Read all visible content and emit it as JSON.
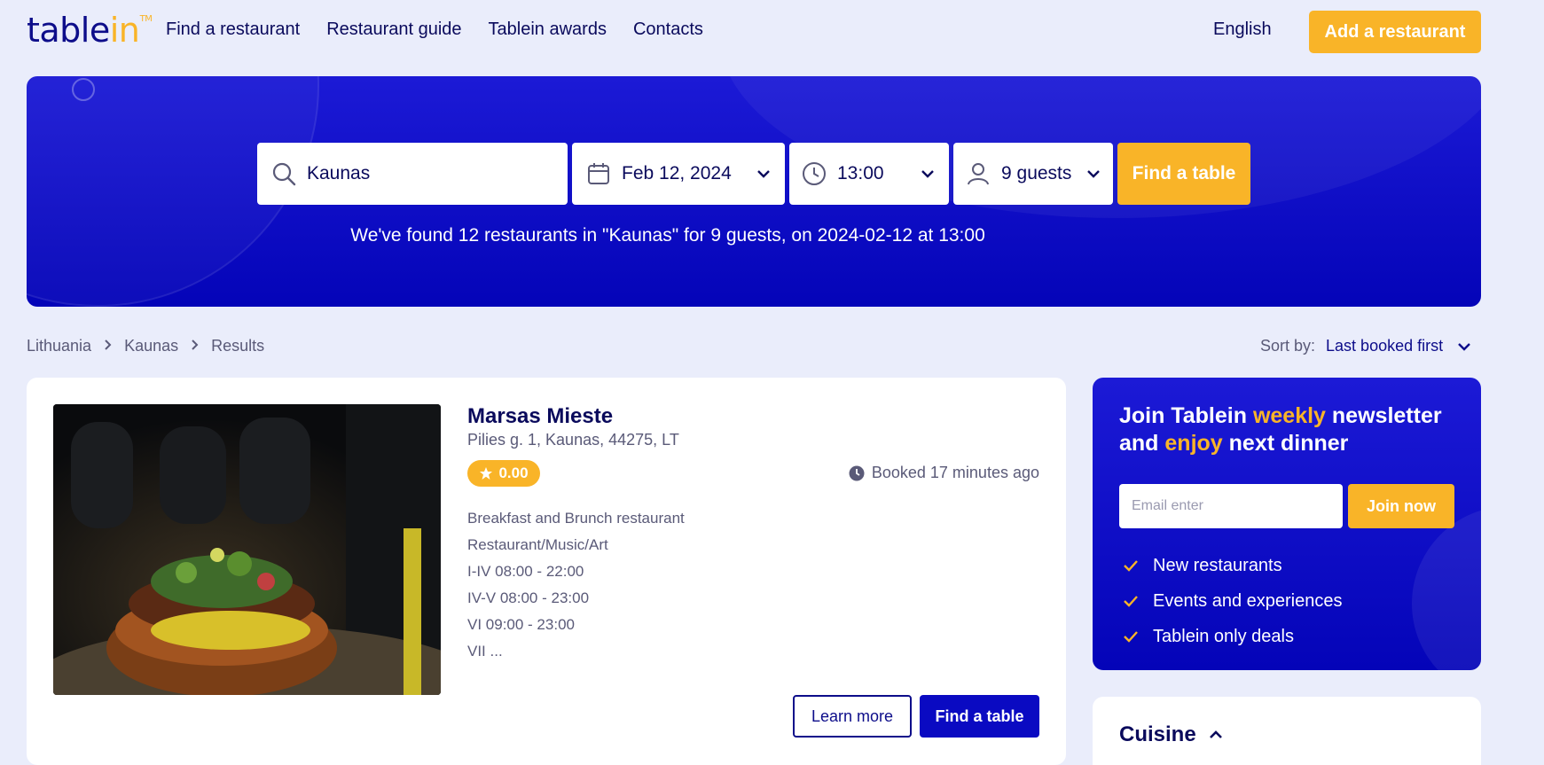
{
  "header": {
    "logo_main": "table",
    "logo_accent": "in",
    "logo_tm": "TM",
    "nav": [
      "Find a restaurant",
      "Restaurant guide",
      "Tablein awards",
      "Contacts"
    ],
    "language": "English",
    "add_restaurant": "Add a restaurant"
  },
  "search": {
    "location": "Kaunas",
    "date": "Feb 12, 2024",
    "time": "13:00",
    "guests": "9 guests",
    "submit": "Find a table",
    "summary": "We've found 12 restaurants in \"Kaunas\" for 9 guests, on 2024-02-12 at 13:00"
  },
  "breadcrumb": [
    "Lithuania",
    "Kaunas",
    "Results"
  ],
  "sort": {
    "label": "Sort by:",
    "value": "Last booked first"
  },
  "result": {
    "name": "Marsas Mieste",
    "address": "Pilies g. 1, Kaunas, 44275, LT",
    "rating": "0.00",
    "booked": "Booked 17 minutes ago",
    "details": [
      "Breakfast and Brunch restaurant",
      "Restaurant/Music/Art",
      "I-IV 08:00 - 22:00",
      "IV-V 08:00 - 23:00",
      "VI 09:00 - 23:00",
      "VII ..."
    ],
    "learn_more": "Learn more",
    "find_table": "Find a table"
  },
  "newsletter": {
    "t1": "Join Tablein ",
    "t2": "weekly",
    "t3": " newsletter",
    "t4": "and ",
    "t5": "enjoy",
    "t6": " next dinner",
    "email_placeholder": "Email enter",
    "join": "Join now",
    "perks": [
      "New restaurants",
      "Events and experiences",
      "Tablein only deals"
    ]
  },
  "filters": {
    "cuisine": "Cuisine"
  },
  "colors": {
    "brand_blue": "#0d0d8a",
    "accent_yellow": "#f9b428",
    "hero_blue": "#0404b8",
    "page_bg": "#eaedfb"
  }
}
